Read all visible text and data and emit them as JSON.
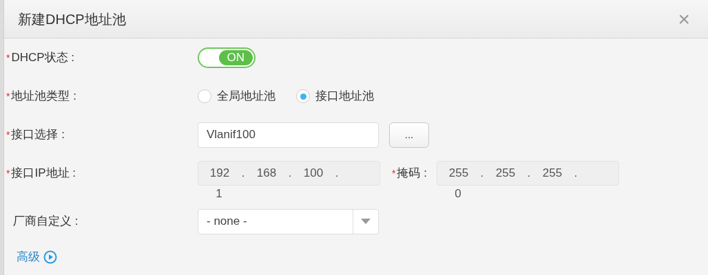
{
  "dialog": {
    "title": "新建DHCP地址池",
    "close": "×"
  },
  "fields": [
    {
      "kind": "switch",
      "label": "DHCP状态 :",
      "required_mark": "*",
      "on": true,
      "text": "ON"
    },
    {
      "kind": "radio",
      "label": "地址池类型 :",
      "required_mark": "*",
      "options": [
        {
          "label": "全局地址池",
          "selected": false
        },
        {
          "label": "接口地址池",
          "selected": true
        }
      ]
    },
    {
      "kind": "picker",
      "label": "接口选择 :",
      "required_mark": "*",
      "value": "Vlanif100",
      "button": "..."
    },
    {
      "kind": "ip",
      "label": "接口IP地址 :",
      "required_mark": "*",
      "separator": ".",
      "octets": [
        "192",
        "168",
        "100",
        "1"
      ],
      "mask_label": "掩码 :",
      "mask_required_mark": "*",
      "mask_octets": [
        "255",
        "255",
        "255",
        "0"
      ]
    },
    {
      "kind": "select",
      "label": "厂商自定义 :",
      "value": "- none -"
    }
  ],
  "advanced": {
    "label": "高级"
  }
}
